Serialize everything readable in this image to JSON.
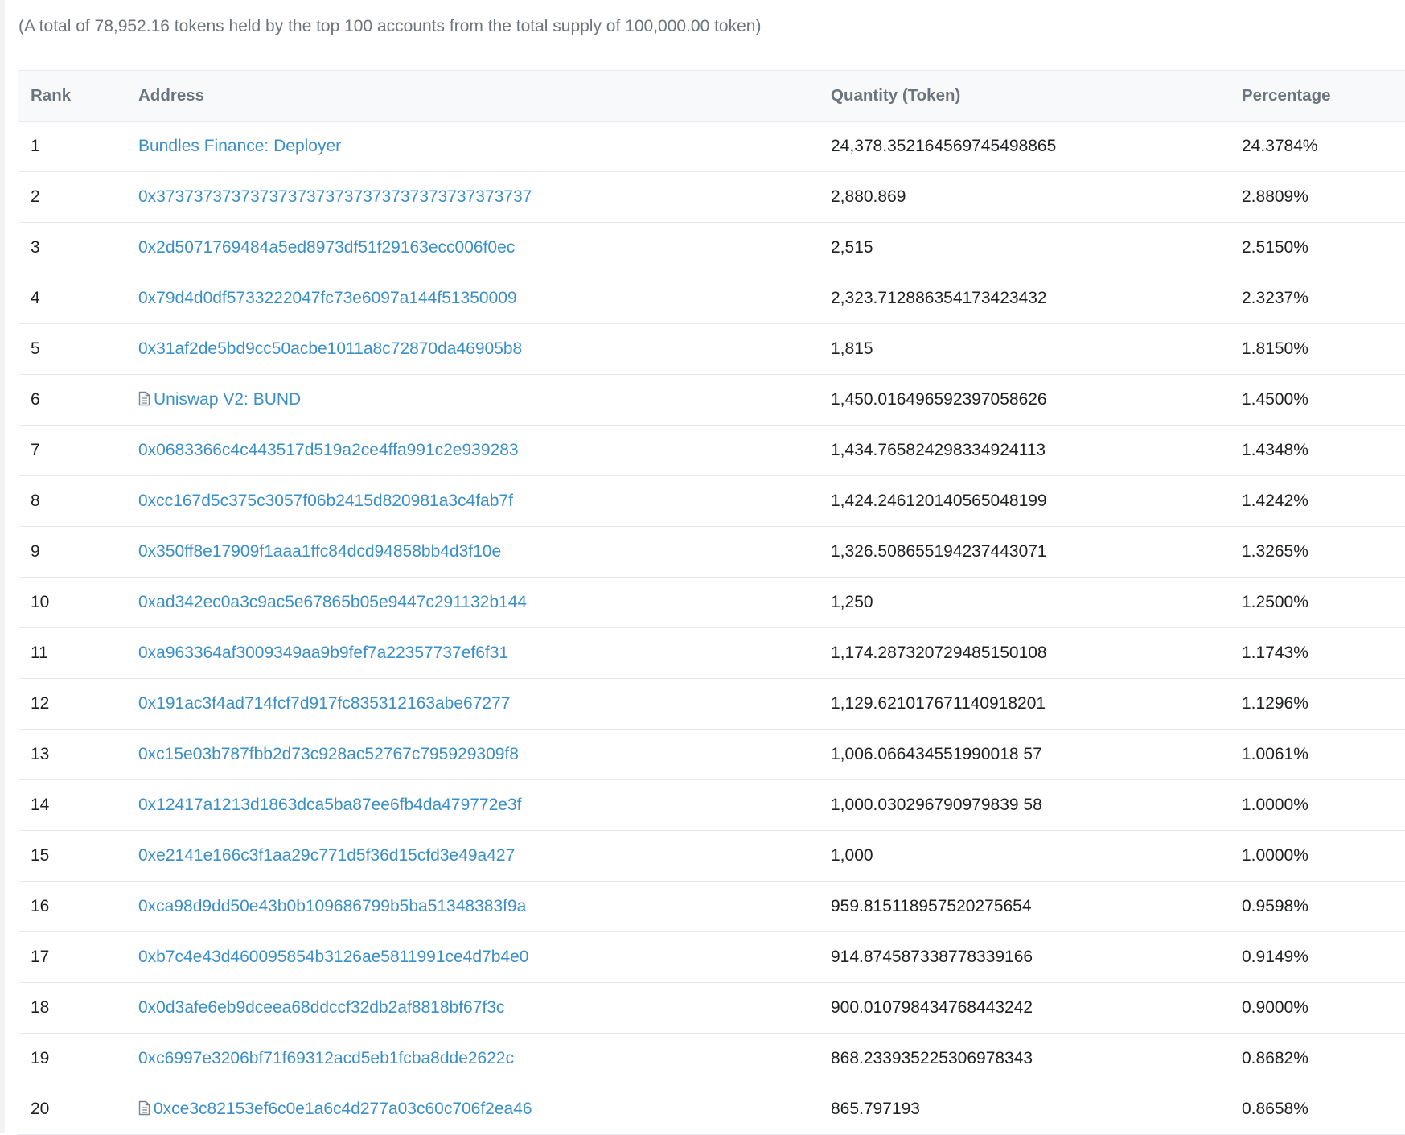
{
  "summary": "(A total of 78,952.16 tokens held by the top 100 accounts from the total supply of 100,000.00 token)",
  "headers": {
    "rank": "Rank",
    "address": "Address",
    "quantity": "Quantity (Token)",
    "percentage": "Percentage"
  },
  "colors": {
    "link": "#3a8fc7",
    "header_text": "#6c757d",
    "row_border": "#e7eaf3"
  },
  "rows": [
    {
      "rank": "1",
      "address": "Bundles Finance: Deployer",
      "contract": false,
      "quantity": "24,378.352164569745498865",
      "percentage": "24.3784%"
    },
    {
      "rank": "2",
      "address": "0x3737373737373737373737373737373737373737",
      "contract": false,
      "quantity": "2,880.869",
      "percentage": "2.8809%"
    },
    {
      "rank": "3",
      "address": "0x2d5071769484a5ed8973df51f29163ecc006f0ec",
      "contract": false,
      "quantity": "2,515",
      "percentage": "2.5150%"
    },
    {
      "rank": "4",
      "address": "0x79d4d0df5733222047fc73e6097a144f51350009",
      "contract": false,
      "quantity": "2,323.712886354173423432",
      "percentage": "2.3237%"
    },
    {
      "rank": "5",
      "address": "0x31af2de5bd9cc50acbe1011a8c72870da46905b8",
      "contract": false,
      "quantity": "1,815",
      "percentage": "1.8150%"
    },
    {
      "rank": "6",
      "address": "Uniswap V2: BUND",
      "contract": true,
      "icon": "contract-file-icon",
      "quantity": "1,450.016496592397058626",
      "percentage": "1.4500%"
    },
    {
      "rank": "7",
      "address": "0x0683366c4c443517d519a2ce4ffa991c2e939283",
      "contract": false,
      "quantity": "1,434.765824298334924113",
      "percentage": "1.4348%"
    },
    {
      "rank": "8",
      "address": "0xcc167d5c375c3057f06b2415d820981a3c4fab7f",
      "contract": false,
      "quantity": "1,424.246120140565048199",
      "percentage": "1.4242%"
    },
    {
      "rank": "9",
      "address": "0x350ff8e17909f1aaa1ffc84dcd94858bb4d3f10e",
      "contract": false,
      "quantity": "1,326.508655194237443071",
      "percentage": "1.3265%"
    },
    {
      "rank": "10",
      "address": "0xad342ec0a3c9ac5e67865b05e9447c291132b144",
      "contract": false,
      "quantity": "1,250",
      "percentage": "1.2500%"
    },
    {
      "rank": "11",
      "address": "0xa963364af3009349aa9b9fef7a22357737ef6f31",
      "contract": false,
      "quantity": "1,174.287320729485150108",
      "percentage": "1.1743%"
    },
    {
      "rank": "12",
      "address": "0x191ac3f4ad714fcf7d917fc835312163abe67277",
      "contract": false,
      "quantity": "1,129.621017671140918201",
      "percentage": "1.1296%"
    },
    {
      "rank": "13",
      "address": "0xc15e03b787fbb2d73c928ac52767c795929309f8",
      "contract": false,
      "quantity": "1,006.066434551990018 57",
      "percentage": "1.0061%"
    },
    {
      "rank": "14",
      "address": "0x12417a1213d1863dca5ba87ee6fb4da479772e3f",
      "contract": false,
      "quantity": "1,000.030296790979839 58",
      "percentage": "1.0000%"
    },
    {
      "rank": "15",
      "address": "0xe2141e166c3f1aa29c771d5f36d15cfd3e49a427",
      "contract": false,
      "quantity": "1,000",
      "percentage": "1.0000%"
    },
    {
      "rank": "16",
      "address": "0xca98d9dd50e43b0b109686799b5ba51348383f9a",
      "contract": false,
      "quantity": "959.815118957520275654",
      "percentage": "0.9598%"
    },
    {
      "rank": "17",
      "address": "0xb7c4e43d460095854b3126ae5811991ce4d7b4e0",
      "contract": false,
      "quantity": "914.874587338778339166",
      "percentage": "0.9149%"
    },
    {
      "rank": "18",
      "address": "0x0d3afe6eb9dceea68ddccf32db2af8818bf67f3c",
      "contract": false,
      "quantity": "900.010798434768443242",
      "percentage": "0.9000%"
    },
    {
      "rank": "19",
      "address": "0xc6997e3206bf71f69312acd5eb1fcba8dde2622c",
      "contract": false,
      "quantity": "868.233935225306978343",
      "percentage": "0.8682%"
    },
    {
      "rank": "20",
      "address": "0xce3c82153ef6c0e1a6c4d277a03c60c706f2ea46",
      "contract": true,
      "icon": "contract-file-icon",
      "quantity": "865.797193",
      "percentage": "0.8658%"
    }
  ]
}
